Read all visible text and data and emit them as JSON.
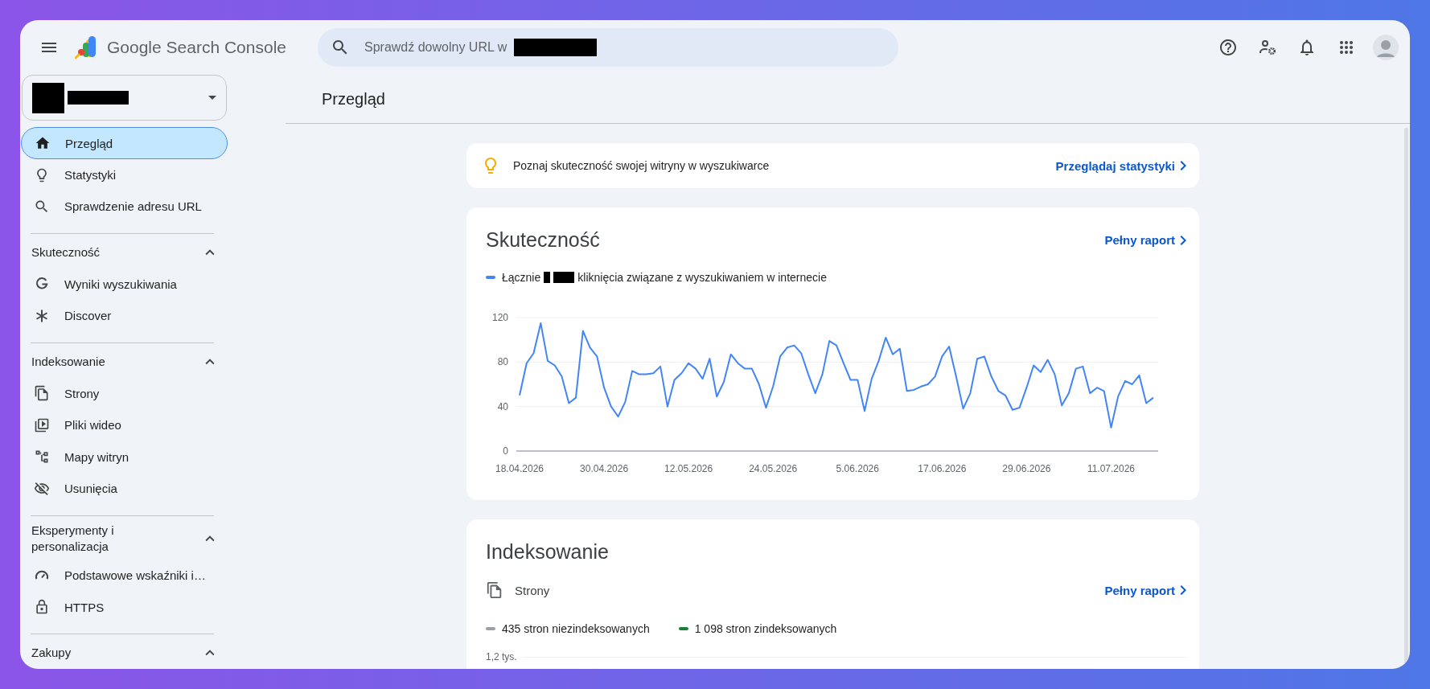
{
  "header": {
    "product_name": "Google Search Console",
    "search": {
      "placeholder": "Sprawdź dowolny URL w"
    }
  },
  "sidebar": {
    "top_items": [
      {
        "label": "Przegląd",
        "selected": true
      },
      {
        "label": "Statystyki",
        "selected": false
      },
      {
        "label": "Sprawdzenie adresu URL",
        "selected": false
      }
    ],
    "sections": [
      {
        "title": "Skuteczność",
        "expanded": true,
        "items": [
          {
            "label": "Wyniki wyszukiwania",
            "selected": false
          },
          {
            "label": "Discover",
            "selected": false
          }
        ]
      },
      {
        "title": "Indeksowanie",
        "expanded": true,
        "items": [
          {
            "label": "Strony",
            "selected": false
          },
          {
            "label": "Pliki wideo",
            "selected": false
          },
          {
            "label": "Mapy witryn",
            "selected": false
          },
          {
            "label": "Usunięcia",
            "selected": false
          }
        ]
      },
      {
        "title": "Eksperymenty i personalizacja",
        "expanded": true,
        "items": [
          {
            "label": "Podstawowe wskaźniki i…",
            "selected": false
          },
          {
            "label": "HTTPS",
            "selected": false
          }
        ]
      },
      {
        "title": "Zakupy",
        "expanded": true
      }
    ]
  },
  "page_title": "Przegląd",
  "insight_card": {
    "text": "Poznaj skuteczność swojej witryny w wyszukiwarce",
    "link": "Przeglądaj statystyki"
  },
  "performance_card": {
    "title": "Skuteczność",
    "link": "Pełny raport",
    "legend_prefix": "Łącznie",
    "legend_suffix": "kliknięcia związane z wyszukiwaniem w internecie",
    "chart_data": {
      "type": "line",
      "categories": [
        "18.04.2026",
        null,
        null,
        null,
        null,
        null,
        null,
        null,
        null,
        null,
        null,
        null,
        "30.04.2026",
        null,
        null,
        null,
        null,
        null,
        null,
        null,
        null,
        null,
        null,
        null,
        "12.05.2026",
        null,
        null,
        null,
        null,
        null,
        null,
        null,
        null,
        null,
        null,
        null,
        "24.05.2026",
        null,
        null,
        null,
        null,
        null,
        null,
        null,
        null,
        null,
        null,
        null,
        "5.06.2026",
        null,
        null,
        null,
        null,
        null,
        null,
        null,
        null,
        null,
        null,
        null,
        "17.06.2026",
        null,
        null,
        null,
        null,
        null,
        null,
        null,
        null,
        null,
        null,
        null,
        "29.06.2026",
        null,
        null,
        null,
        null,
        null,
        null,
        null,
        null,
        null,
        null,
        null,
        "11.07.2026",
        null,
        null,
        null,
        null,
        null,
        null
      ],
      "series": [
        {
          "color": "#4285f4",
          "values": [
            50,
            79,
            88,
            115,
            81,
            77,
            67,
            43,
            48,
            108,
            93,
            85,
            57,
            40,
            31,
            44,
            72,
            69,
            69,
            70,
            76,
            40,
            64,
            70,
            79,
            74,
            65,
            83,
            49,
            62,
            87,
            79,
            74,
            74,
            60,
            39,
            58,
            85,
            93,
            95,
            88,
            69,
            52,
            69,
            99,
            95,
            79,
            64,
            64,
            36,
            65,
            81,
            102,
            87,
            92,
            54,
            55,
            58,
            60,
            67,
            85,
            94,
            67,
            38,
            52,
            83,
            85,
            67,
            54,
            50,
            37,
            39,
            57,
            77,
            71,
            82,
            69,
            41,
            52,
            74,
            76,
            52,
            57,
            54,
            21,
            49,
            63,
            60,
            68,
            43,
            48
          ]
        }
      ],
      "ylim": [
        0,
        120
      ],
      "yticks": [
        0,
        40,
        80,
        120
      ]
    }
  },
  "indexing_card": {
    "title": "Indeksowanie",
    "subtitle": "Strony",
    "link": "Pełny raport",
    "legend": [
      {
        "label": "435 stron niezindeksowanych",
        "color": "#9aa0a6"
      },
      {
        "label": "1 098 stron zindeksowanych",
        "color": "#188038"
      }
    ],
    "y_tick_label": "1,2 tys."
  }
}
